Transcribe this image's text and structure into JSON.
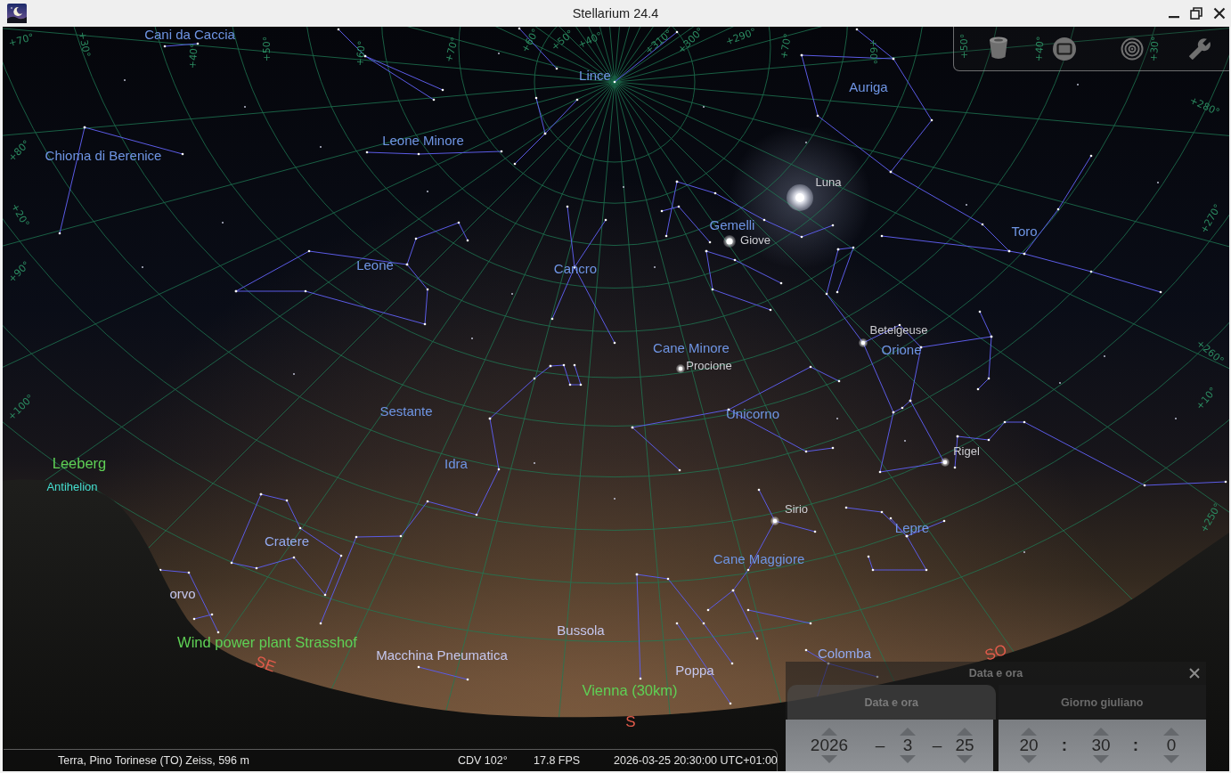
{
  "window": {
    "title": "Stellarium 24.4"
  },
  "sky": {
    "grid_labels": [
      "+70°",
      "+30°",
      "+40°",
      "+50°",
      "+60°",
      "+70°",
      "+60°",
      "+50°",
      "+40°",
      "+310°",
      "+300°",
      "+290°",
      "+70°",
      "+60°",
      "+50°",
      "+40°",
      "+30°",
      "+280°",
      "+270°",
      "+260°",
      "+10°",
      "+250°",
      "+80°",
      "+20°",
      "+90°",
      "+100°"
    ],
    "constellation_labels": [
      "Cani da Caccia",
      "Lince",
      "Auriga",
      "Leone Minore",
      "Chioma di Berenice",
      "Gemelli",
      "Toro",
      "Leone",
      "Cancro",
      "Cane Minore",
      "Orione",
      "Sestante",
      "Unicorno",
      "Idra",
      "Cratere",
      "Lepre",
      "Cane Maggiore",
      "orvo",
      "Bussola",
      "Macchina Pneumatica",
      "Poppa",
      "Colomba"
    ],
    "objects": [
      {
        "name": "Luna",
        "kind": "moon"
      },
      {
        "name": "Giove",
        "kind": "planet"
      },
      {
        "name": "Betelgeuse",
        "kind": "star"
      },
      {
        "name": "Procione",
        "kind": "star"
      },
      {
        "name": "Rigel",
        "kind": "star"
      },
      {
        "name": "Sirio",
        "kind": "star"
      }
    ],
    "landmark_labels": [
      "Leeberg",
      "Wind power plant Strasshof",
      "Vienna (30km)"
    ],
    "antihelion_label": "Antihelion",
    "cardinal_points": [
      "SE",
      "S",
      "SO"
    ]
  },
  "date_time_dialog": {
    "title": "Data e ora",
    "tabs": [
      {
        "label": "Data e ora",
        "selected": true
      },
      {
        "label": "Giorno giuliano",
        "selected": false
      }
    ],
    "date_parts": [
      "2026",
      "3",
      "25"
    ],
    "date_separators": [
      "–",
      "–"
    ],
    "time_parts": [
      "20",
      "30",
      "0"
    ],
    "time_separators": [
      ":",
      ":"
    ]
  },
  "status_bar": {
    "location": "Terra, Pino Torinese (TO) Zeiss, 596 m",
    "field_of_view": "CDV 102°",
    "frame_rate": "17.8 FPS",
    "date_time": "2026-03-25 20:30:00 UTC+01:00"
  }
}
